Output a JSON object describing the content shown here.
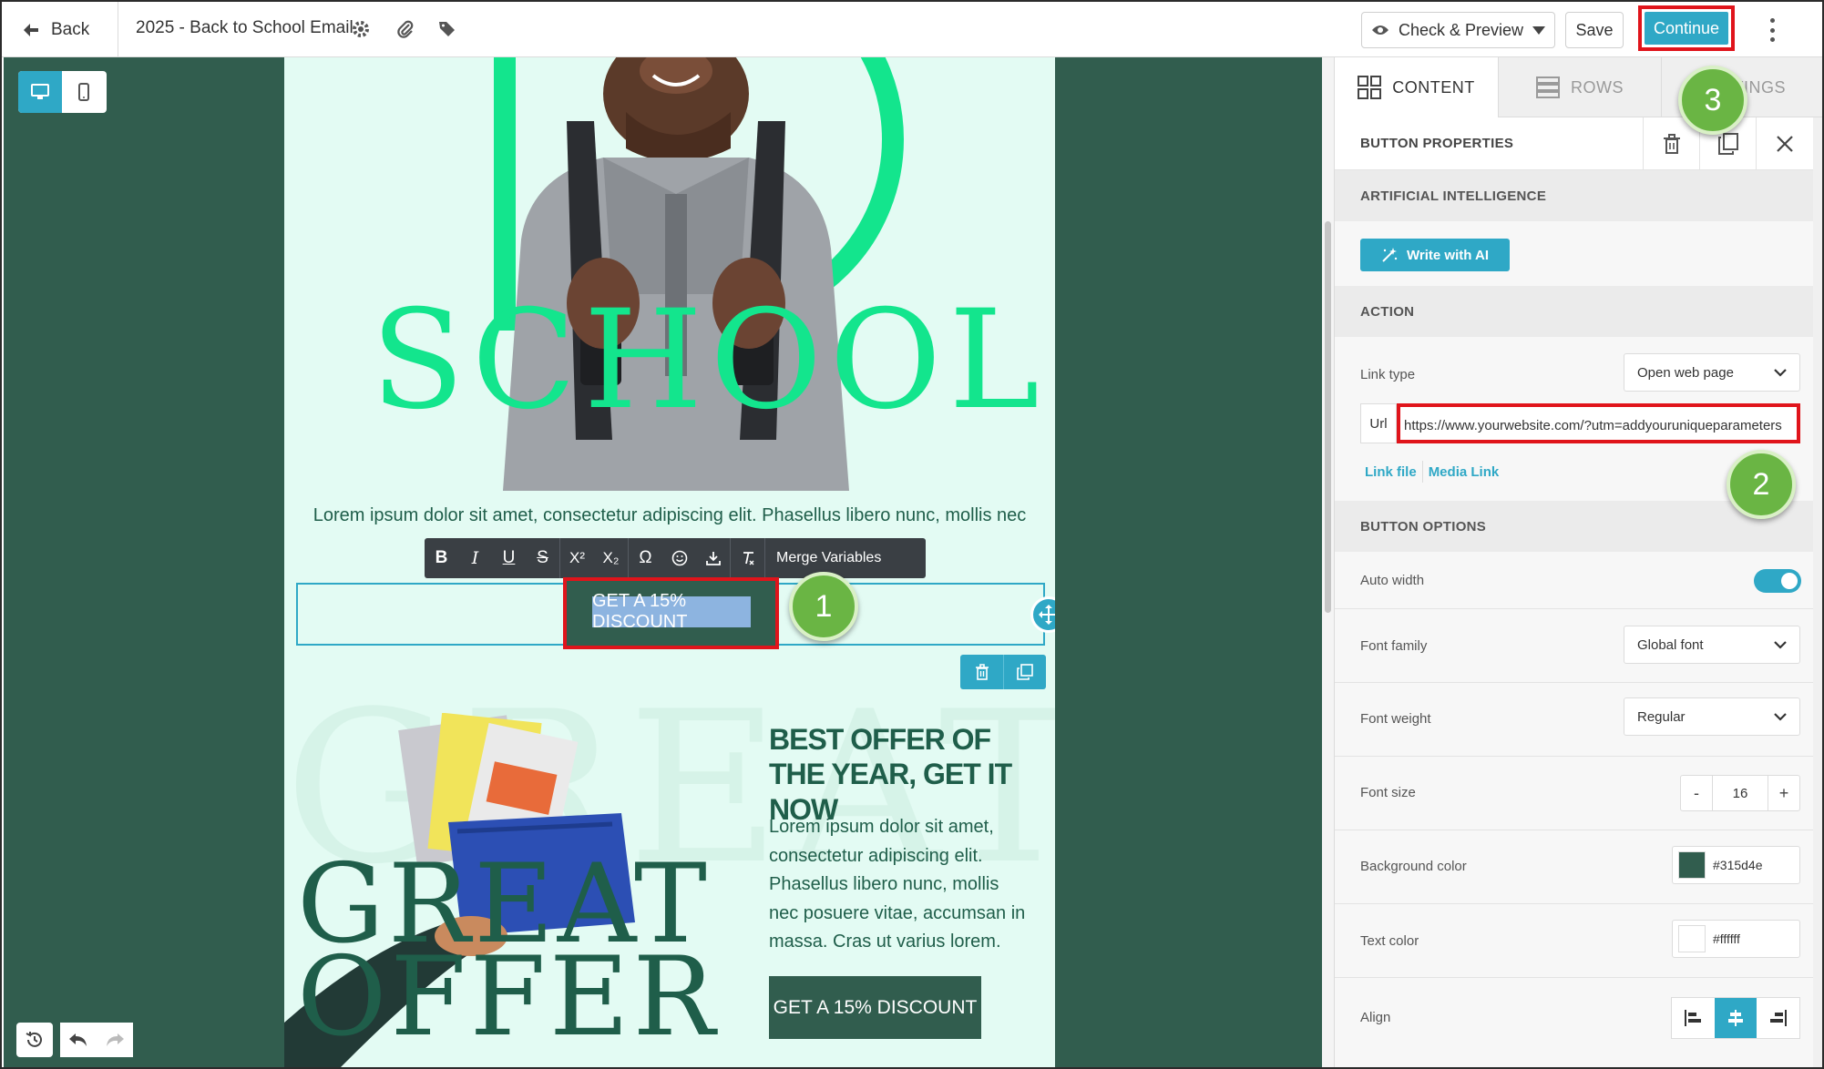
{
  "topbar": {
    "back_label": "Back",
    "doc_title": "2025 - Back to School Email",
    "check_preview_label": "Check & Preview",
    "save_label": "Save",
    "continue_label": "Continue"
  },
  "email": {
    "hero_word": "SCHOOL",
    "lorem_line": "Lorem ipsum dolor sit amet, consectetur adipiscing elit. Phasellus libero nunc, mollis nec",
    "cta_selected": "GET A 15% DISCOUNT",
    "great_word_1": "GREAT",
    "great_word_2": "OFFER",
    "offer_title": "BEST OFFER OF THE YEAR, GET IT NOW",
    "offer_body": "Lorem ipsum dolor sit amet, consectetur adipiscing elit. Phasellus libero nunc, mollis nec posuere vitae, accumsan in massa. Cras ut varius lorem.",
    "cta_second": "GET A 15% DISCOUNT"
  },
  "text_toolbar": {
    "bold": "B",
    "italic": "I",
    "underline": "U",
    "strike": "S",
    "superscript": "X²",
    "subscript": "X₂",
    "omega": "Ω",
    "merge_label": "Merge Variables"
  },
  "callouts": [
    "1",
    "2",
    "3"
  ],
  "panel": {
    "tabs": [
      {
        "label": "CONTENT",
        "icon": "grid-icon"
      },
      {
        "label": "ROWS",
        "icon": "rows-icon"
      },
      {
        "label": "SETTINGS",
        "icon": "settings-icon"
      }
    ],
    "properties_title": "BUTTON PROPERTIES",
    "ai_section": "ARTIFICIAL INTELLIGENCE",
    "ai_button": "Write with AI",
    "action_section": "ACTION",
    "link_type_label": "Link type",
    "link_type_value": "Open web page",
    "url_label": "Url",
    "url_value": "https://www.yourwebsite.com/?utm=addyouruniqueparameters",
    "link_file": "Link file",
    "media_link": "Media Link",
    "button_options_section": "BUTTON OPTIONS",
    "auto_width_label": "Auto width",
    "auto_width_on": true,
    "font_family_label": "Font family",
    "font_family_value": "Global font",
    "font_weight_label": "Font weight",
    "font_weight_value": "Regular",
    "font_size_label": "Font size",
    "font_size_value": "16",
    "font_size_minus": "-",
    "font_size_plus": "+",
    "bg_color_label": "Background color",
    "bg_color_value": "#315d4e",
    "text_color_label": "Text color",
    "text_color_value": "#ffffff",
    "align_label": "Align"
  },
  "colors": {
    "accent": "#2fa8c6",
    "brand_dark": "#315d4e",
    "brand_green": "#13e58d",
    "highlight_red": "#e0141b",
    "callout_green": "#6ab544"
  }
}
